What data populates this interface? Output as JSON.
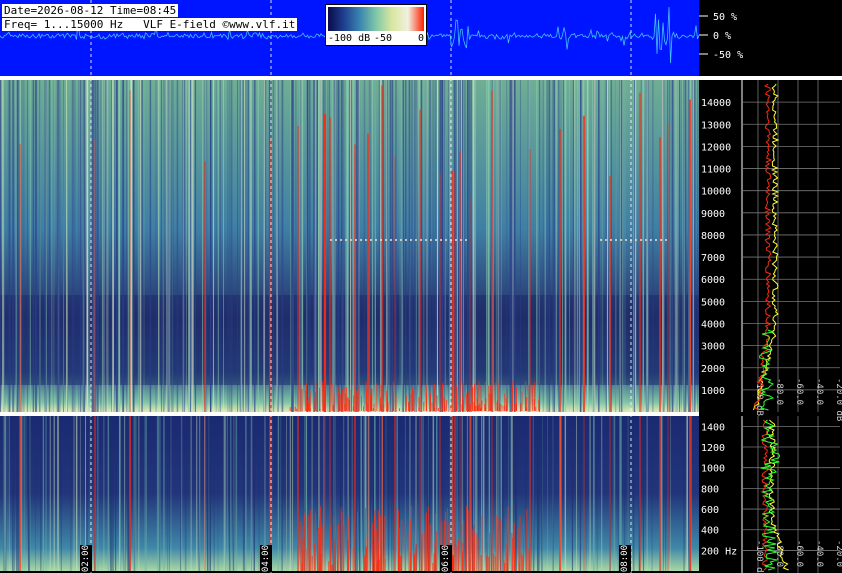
{
  "header": {
    "line1": "Date=2026-08-12 Time=08:45",
    "line2": "Freq= 1...15000 Hz   VLF E-field ©www.vlf.it"
  },
  "colorbar": {
    "labels": [
      "-100 dB",
      "-50",
      "0"
    ],
    "colors": [
      "#0a0a4a",
      "#1f3f8f",
      "#3a86b0",
      "#7fc7a8",
      "#d9e6a0",
      "#f0f0e0",
      "#ff1e00"
    ]
  },
  "waveform": {
    "pct_labels": [
      "50 %",
      "0 %",
      "-50 %"
    ],
    "background": "#0015ff",
    "trace_color": "#40c0ff"
  },
  "time_labels": [
    "02:00",
    "04:00",
    "06:00",
    "08:00"
  ],
  "chart_data": [
    {
      "type": "heatmap",
      "name_hidden": "spectrogram-full",
      "y_ticks": [
        2000,
        3000,
        4000,
        5000,
        6000,
        7000,
        8000,
        9000,
        10000,
        11000,
        12000,
        13000,
        14000
      ],
      "y_tick_labels": [
        "1000",
        "2000",
        "3000",
        "4000",
        "5000",
        "6000",
        "7000",
        "8000",
        "9000",
        "10000",
        "11000",
        "12000",
        "13000",
        "14000"
      ],
      "ylim": [
        1,
        15000
      ]
    },
    {
      "type": "heatmap",
      "name_hidden": "spectrogram-low",
      "y_tick_labels": [
        "200 Hz",
        "400",
        "600",
        "800",
        "1000",
        "1200",
        "1400"
      ],
      "ylim": [
        1,
        1500
      ]
    },
    {
      "type": "line",
      "name_hidden": "spectrum-profile",
      "x_tick_labels": [
        "-100 dB",
        "-80.0",
        "-60.0",
        "-40.0",
        "-20.0 dB"
      ],
      "xlim": [
        -100,
        -20
      ]
    }
  ]
}
